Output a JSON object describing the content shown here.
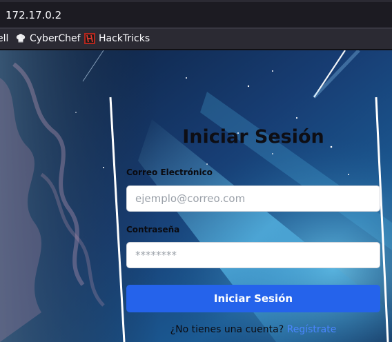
{
  "browser": {
    "url": "172.17.0.2",
    "bookmarks": [
      {
        "label": "ell",
        "icon": "bookmark-icon"
      },
      {
        "label": "CyberChef",
        "icon": "chef-hat-icon"
      },
      {
        "label": "HackTricks",
        "icon": "hacktricks-icon"
      }
    ]
  },
  "login": {
    "title": "Iniciar Sesión",
    "email_label": "Correo Electrónico",
    "email_placeholder": "ejemplo@correo.com",
    "password_label": "Contraseña",
    "password_placeholder": "********",
    "submit_label": "Iniciar Sesión",
    "signup_prompt": "¿No tienes una cuenta?",
    "signup_link": "Regístrate"
  },
  "colors": {
    "accent": "#2563eb",
    "link": "#4a86ff",
    "chrome": "#2b2a33"
  }
}
